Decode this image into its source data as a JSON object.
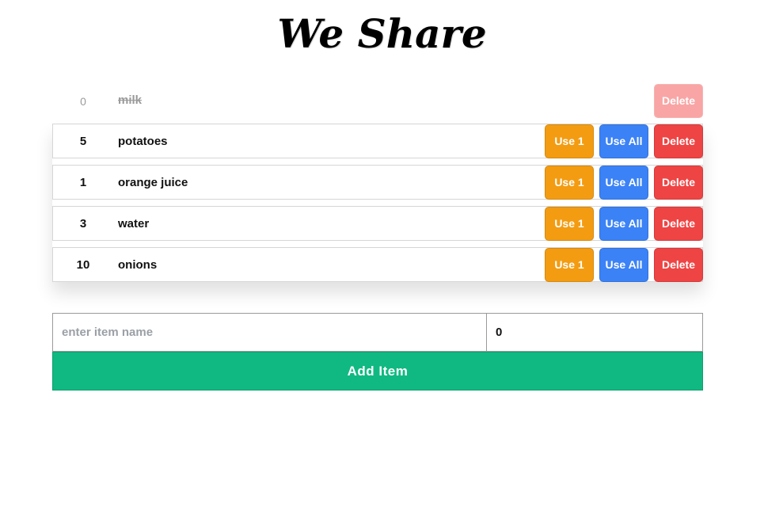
{
  "app": {
    "title": "We Share"
  },
  "items": [
    {
      "qty": "0",
      "name": "milk",
      "done": true,
      "delete_label": "Delete"
    },
    {
      "qty": "5",
      "name": "potatoes",
      "use1_label": "Use 1",
      "useall_label": "Use All",
      "delete_label": "Delete"
    },
    {
      "qty": "1",
      "name": "orange juice",
      "use1_label": "Use 1",
      "useall_label": "Use All",
      "delete_label": "Delete"
    },
    {
      "qty": "3",
      "name": "water",
      "use1_label": "Use 1",
      "useall_label": "Use All",
      "delete_label": "Delete"
    },
    {
      "qty": "10",
      "name": "onions",
      "use1_label": "Use 1",
      "useall_label": "Use All",
      "delete_label": "Delete"
    }
  ],
  "form": {
    "name_placeholder": "enter item name",
    "name_value": "",
    "qty_value": "0",
    "add_label": "Add Item"
  },
  "colors": {
    "use1": "#f39c12",
    "useall": "#3b82f6",
    "delete": "#ef4444",
    "delete_faded": "#f9a5a5",
    "add": "#10b981"
  }
}
